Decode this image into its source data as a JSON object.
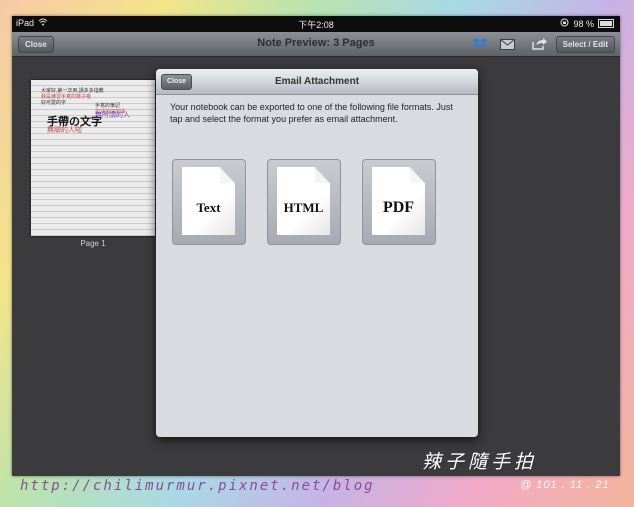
{
  "status_bar": {
    "device": "iPad",
    "time": "下午2:08",
    "battery": "98 %",
    "battery_level": 0.98
  },
  "nav_bar": {
    "close_label": "Close",
    "title": "Note Preview: 3 Pages",
    "select_edit_label": "Select / Edit",
    "icons": [
      "dropbox-icon",
      "mail-icon",
      "share-icon"
    ]
  },
  "thumbnail": {
    "page_label": "Page 1",
    "title": "手帶の文字",
    "lines": [
      "大家好,第一次用,請多多指教",
      "我是練習手寫的樣子喔",
      "好可愛的字",
      "手寫的筆記",
      "加油加油加油"
    ],
    "handwriting_1": "無所謂的人",
    "handwriting_2": "無聊的人啦"
  },
  "modal": {
    "close_label": "Close",
    "title": "Email Attachment",
    "description": "Your notebook can be exported to one of the following file formats. Just tap and select the format you prefer as email attachment.",
    "formats": [
      {
        "label": "Text"
      },
      {
        "label": "HTML"
      },
      {
        "label": "PDF"
      }
    ]
  },
  "watermark": {
    "title": "辣子隨手拍",
    "url": "http://chilimurmur.pixnet.net/blog",
    "date": "@ 101 . 11 . 21"
  },
  "colors": {
    "modal_bg": "#d9dbe0",
    "navbar": "#6f7379",
    "screen_bg": "#3a3a3c"
  }
}
